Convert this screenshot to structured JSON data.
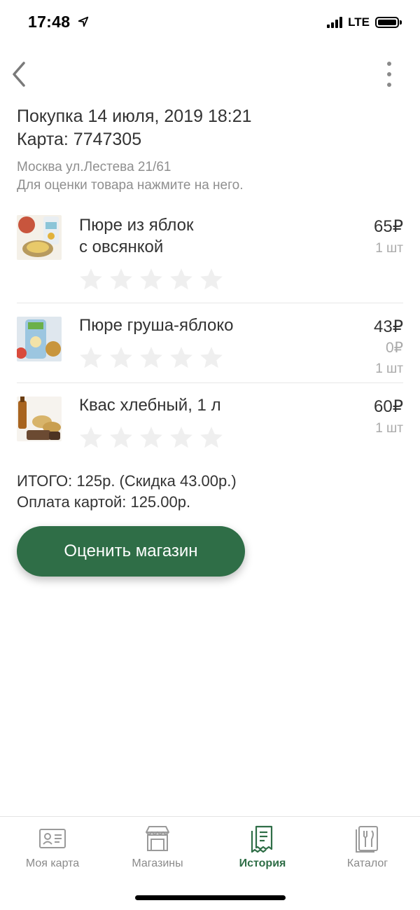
{
  "status": {
    "time": "17:48",
    "network": "LTE"
  },
  "header": {
    "back_icon": "chevron-left-icon",
    "menu_icon": "more-vertical-icon"
  },
  "purchase": {
    "title": "Покупка 14 июля, 2019 18:21",
    "card": "Карта: 7747305",
    "address": "Москва ул.Лестева 21/61",
    "hint": "Для оценки товара нажмите на него."
  },
  "items": [
    {
      "name_line1": "Пюре из яблок",
      "name_line2": "с овсянкой",
      "price": "65₽",
      "discount": "",
      "qty": "1 шт",
      "rating": 0
    },
    {
      "name_line1": "Пюре груша-яблоко",
      "name_line2": "",
      "price": "43₽",
      "discount": "0₽",
      "qty": "1 шт",
      "rating": 0
    },
    {
      "name_line1": "Квас хлебный, 1 л",
      "name_line2": "",
      "price": "60₽",
      "discount": "",
      "qty": "1 шт",
      "rating": 0
    }
  ],
  "totals": {
    "total": "ИТОГО: 125р. (Скидка 43.00р.)",
    "payment": "Оплата картой: 125.00р."
  },
  "rate_button": "Оценить магазин",
  "tabs": [
    {
      "label": "Моя карта",
      "icon": "id-card-icon",
      "active": false
    },
    {
      "label": "Магазины",
      "icon": "store-icon",
      "active": false
    },
    {
      "label": "История",
      "icon": "receipts-icon",
      "active": true
    },
    {
      "label": "Каталог",
      "icon": "cutlery-icon",
      "active": false
    }
  ],
  "colors": {
    "accent": "#2f6e47",
    "text": "#333333",
    "muted": "#8f8f8f",
    "star": "#efefef"
  }
}
